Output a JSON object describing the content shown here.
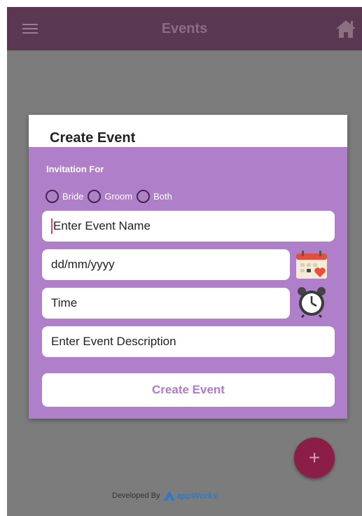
{
  "app": {
    "title": "Events",
    "icons": {
      "menu": "hamburger-icon",
      "home": "home-icon",
      "fab": "plus-icon"
    },
    "colors": {
      "appbar": "#5a3852",
      "dialog": "#b07fca",
      "accent": "#b079cc",
      "fab": "#8a1e46"
    }
  },
  "dialog": {
    "title": "Create Event",
    "invitation_label": "Invitation For",
    "options": [
      "Bride",
      "Groom",
      "Both"
    ],
    "event_name_placeholder": "Enter Event Name",
    "date_placeholder": "dd/mm/yyyy",
    "time_placeholder": "Time",
    "description_placeholder": "Enter Event Description",
    "create_button": "Create Event",
    "icons": {
      "date": "calendar-icon",
      "time": "alarm-clock-icon"
    }
  },
  "fab_label": "+",
  "footer": {
    "text": "Developed By",
    "brand": "appWorks"
  }
}
